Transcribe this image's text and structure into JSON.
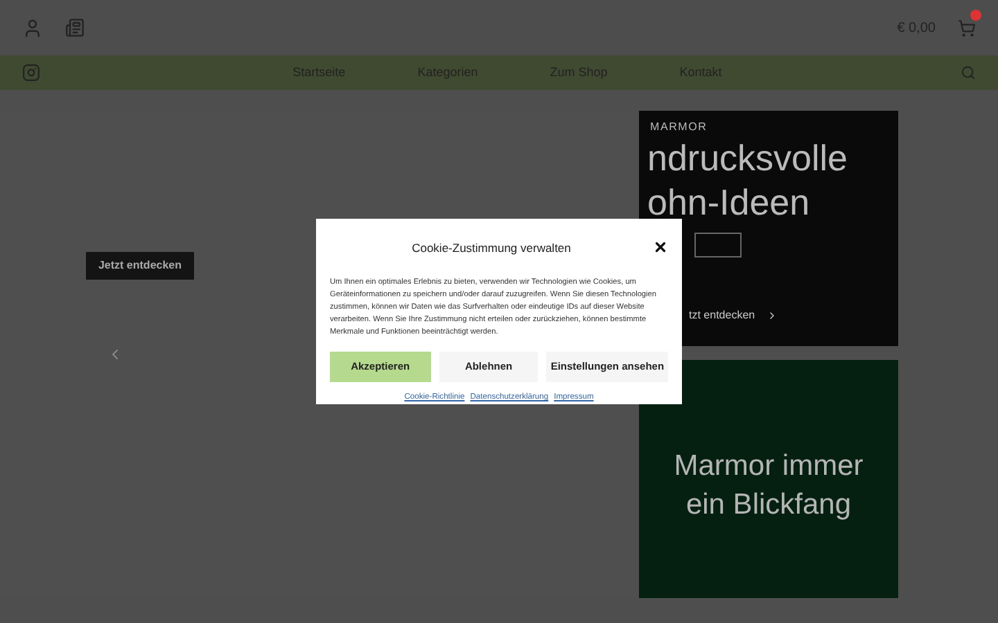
{
  "header": {
    "cart_total": "€ 0,00"
  },
  "nav": {
    "items": [
      {
        "label": "Startseite"
      },
      {
        "label": "Kategorien"
      },
      {
        "label": "Zum Shop"
      },
      {
        "label": "Kontakt"
      }
    ]
  },
  "hero": {
    "button": "Jetzt entdecken"
  },
  "promo_card": {
    "label": "MARMOR",
    "heading_lines": [
      "ndrucksvolle",
      "ohn-Ideen"
    ],
    "link": "tzt entdecken"
  },
  "green_card": {
    "heading": "Marmor immer ein Blickfang"
  },
  "cookie_dialog": {
    "title": "Cookie-Zustimmung verwalten",
    "text": "Um Ihnen ein optimales Erlebnis zu bieten, verwenden wir Technologien wie Cookies, um Geräteinformationen zu speichern und/oder darauf zuzugreifen. Wenn Sie diesen Technologien zustimmen, können wir Daten wie das Surfverhalten oder eindeutige IDs auf dieser Website verarbeiten. Wenn Sie Ihre Zustimmung nicht erteilen oder zurückziehen, können bestimmte Merkmale und Funktionen beeinträchtigt werden.",
    "buttons": [
      {
        "label": "Akzeptieren",
        "kind": "primary"
      },
      {
        "label": "Ablehnen",
        "kind": "secondary"
      },
      {
        "label": "Einstellungen ansehen",
        "kind": "secondary"
      }
    ],
    "links": [
      {
        "label": "Cookie-Richtlinie"
      },
      {
        "label": "Datenschutzerklärung"
      },
      {
        "label": "Impressum"
      }
    ]
  }
}
